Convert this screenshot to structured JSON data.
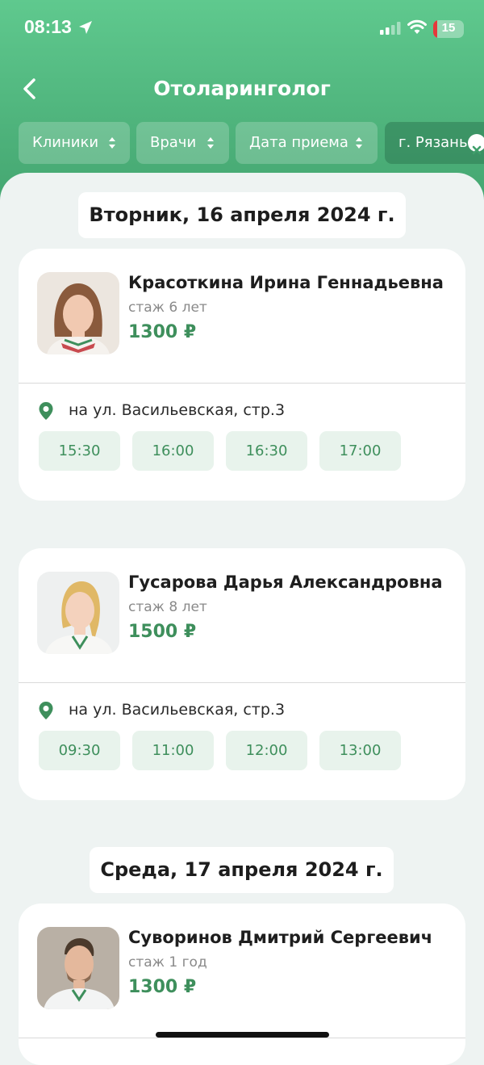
{
  "status_bar": {
    "time": "08:13",
    "battery": "15"
  },
  "header": {
    "title": "Отоларинголог"
  },
  "filters": [
    {
      "label": "Клиники"
    },
    {
      "label": "Врачи"
    },
    {
      "label": "Дата приема"
    },
    {
      "label": "г. Рязань"
    }
  ],
  "days": [
    {
      "date": "Вторник, 16 апреля 2024 г.",
      "doctors": [
        {
          "name": "Красоткина Ирина Геннадьевна",
          "experience": "стаж 6 лет",
          "price": "1300 ₽",
          "address": "на ул. Васильевская, стр.3",
          "slots": [
            "15:30",
            "16:00",
            "16:30",
            "17:00"
          ]
        },
        {
          "name": "Гусарова Дарья Александровна",
          "experience": "стаж 8 лет",
          "price": "1500 ₽",
          "address": "на ул. Васильевская, стр.3",
          "slots": [
            "09:30",
            "11:00",
            "12:00",
            "13:00"
          ]
        }
      ]
    },
    {
      "date": "Среда, 17 апреля 2024 г.",
      "doctors": [
        {
          "name": "Суворинов Дмитрий Сергеевич",
          "experience": "стаж 1 год",
          "price": "1300 ₽"
        }
      ]
    }
  ],
  "colors": {
    "accent": "#3e8f5c",
    "header_top": "#5fc98e",
    "header_bottom": "#3f9f6b",
    "slot_bg": "#e8f3ec"
  },
  "icons": [
    "location-arrow-icon",
    "signal-icon",
    "wifi-icon",
    "battery-icon",
    "back-chevron-icon",
    "sort-icon",
    "clear-icon",
    "map-pin-icon"
  ]
}
